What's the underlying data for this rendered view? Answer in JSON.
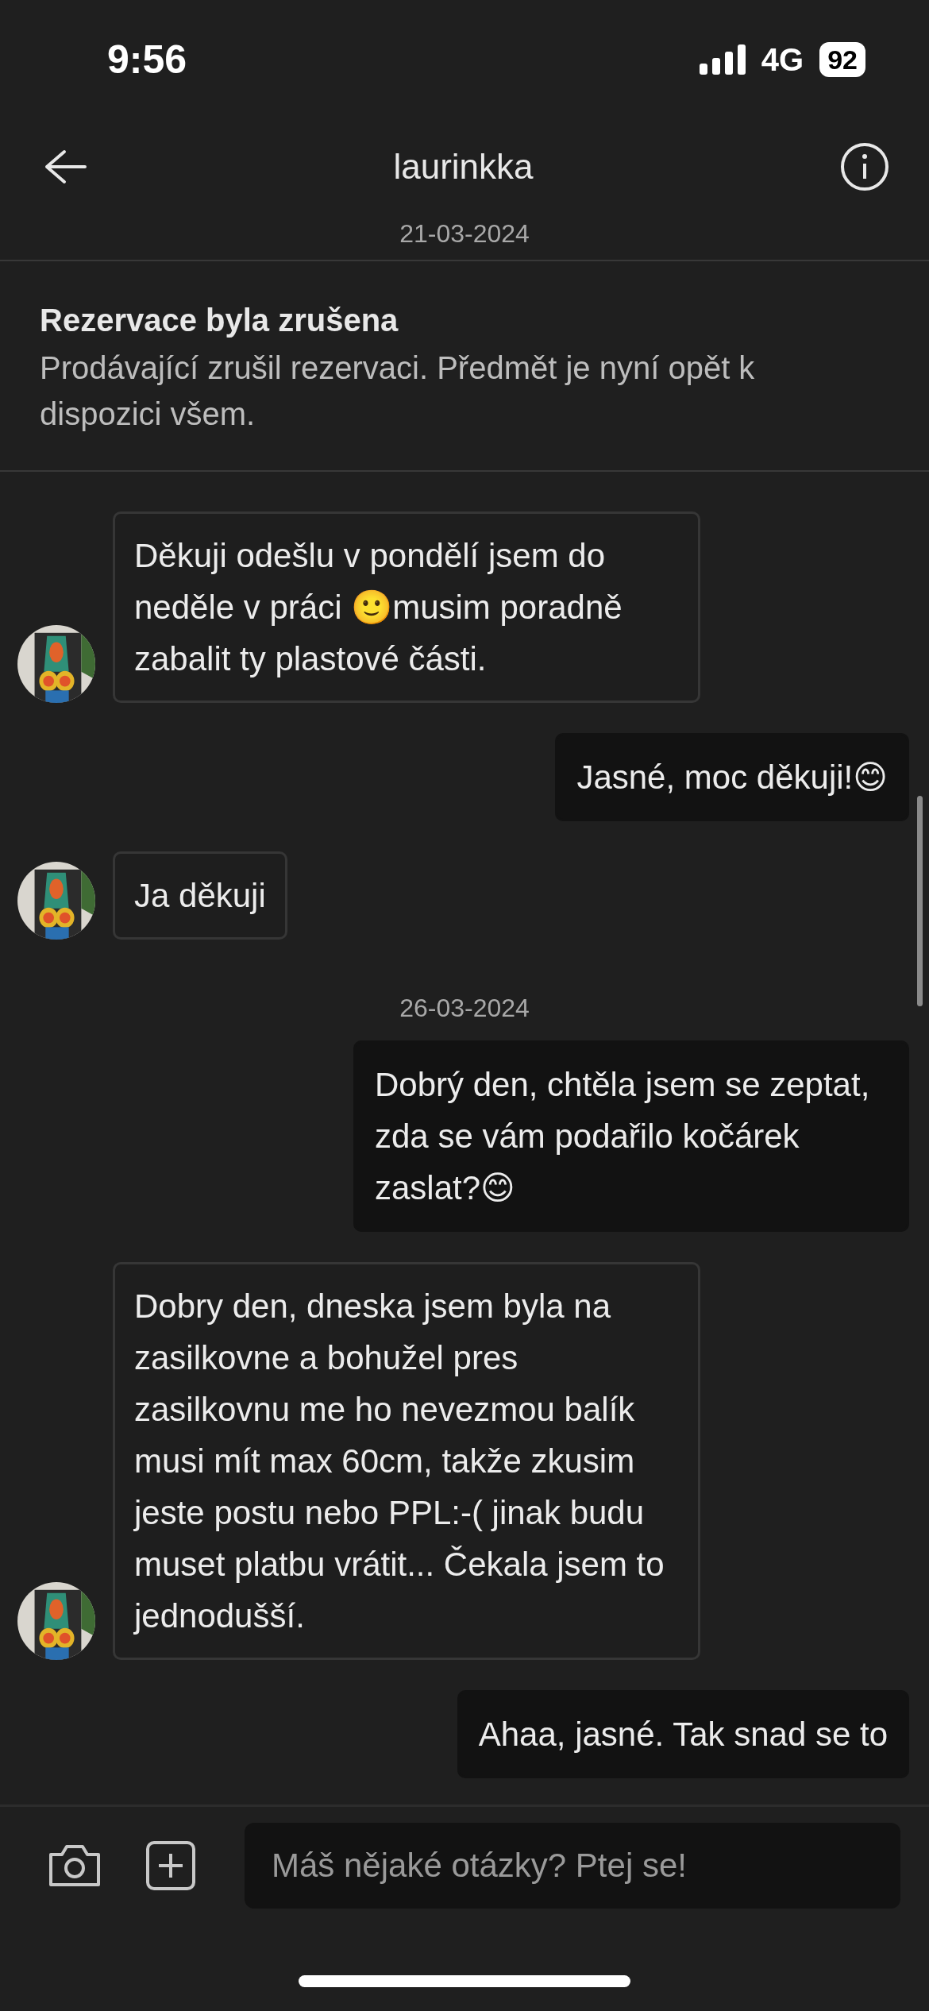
{
  "status_bar": {
    "time": "9:56",
    "network": "4G",
    "battery": "92"
  },
  "header": {
    "title": "laurinkka"
  },
  "conversation": [
    {
      "kind": "date",
      "text": "21-03-2024"
    },
    {
      "kind": "notice",
      "title": "Rezervace byla zrušena",
      "text": "Prodávající zrušil rezervaci. Předmět je nyní opět k dispozici všem."
    },
    {
      "kind": "message",
      "sent": false,
      "text": "Děkuji odešlu v pondělí jsem do neděle v práci 🙂musim poradně zabalit ty plastové části."
    },
    {
      "kind": "message",
      "sent": true,
      "text": "Jasné, moc děkuji!😊"
    },
    {
      "kind": "message",
      "sent": false,
      "text": "Ja děkuji"
    },
    {
      "kind": "date",
      "text": "26-03-2024"
    },
    {
      "kind": "message",
      "sent": true,
      "text": "Dobrý den, chtěla jsem se zeptat, zda se vám podařilo kočárek zaslat?😊"
    },
    {
      "kind": "message",
      "sent": false,
      "text": "Dobry den, dneska jsem byla na zasilkovne a bohužel pres zasilkovnu me ho nevezmou balík musi mít max 60cm, takže zkusim jeste postu nebo PPL:-( jinak budu muset platbu vrátit... Čekala jsem to jednodušší."
    },
    {
      "kind": "message",
      "sent": true,
      "text": "Ahaa, jasné. Tak snad se to"
    }
  ],
  "composer": {
    "placeholder": "Máš nějaké otázky? Ptej se!"
  }
}
